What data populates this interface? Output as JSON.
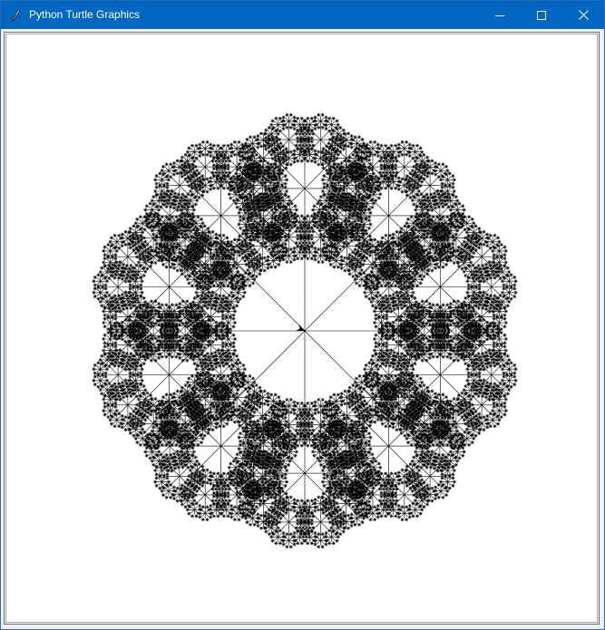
{
  "window": {
    "title": "Python Turtle Graphics",
    "titlebar_color": "#0067c0",
    "icon": "feather-icon"
  },
  "controls": {
    "minimize": "minimize-icon",
    "maximize": "maximize-icon",
    "close": "close-icon"
  },
  "canvas": {
    "background": "#ffffff",
    "stroke_color": "#000000",
    "drawing": "recursive fractal of spoked circles (turtle graphics)",
    "turtle_cursor": "arrow-cursor-icon"
  }
}
